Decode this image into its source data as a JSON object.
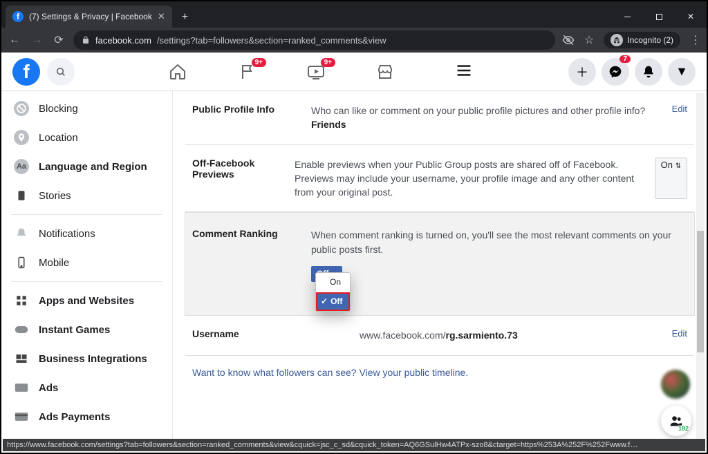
{
  "browser": {
    "tab_title": "(7) Settings & Privacy | Facebook",
    "url_host": "facebook.com",
    "url_path": "/settings?tab=followers&section=ranked_comments&view",
    "incognito_label": "Incognito (2)",
    "status_url": "https://www.facebook.com/settings?tab=followers&section=ranked_comments&view&cquick=jsc_c_sd&cquick_token=AQ6GSulHw4ATPx-szo8&ctarget=https%253A%252F%252Fwww.f…"
  },
  "header": {
    "badges": {
      "pages": "9+",
      "watch": "9+",
      "messenger": "7"
    }
  },
  "sidebar": {
    "items": [
      "Blocking",
      "Location",
      "Language and Region",
      "Stories",
      "Notifications",
      "Mobile",
      "Apps and Websites",
      "Instant Games",
      "Business Integrations",
      "Ads",
      "Ads Payments"
    ]
  },
  "settings": {
    "profile": {
      "label": "Public Profile Info",
      "desc_prefix": "Who can like or comment on your public profile pictures and other profile info? ",
      "desc_value": "Friends",
      "action": "Edit"
    },
    "previews": {
      "label": "Off-Facebook Previews",
      "desc": "Enable previews when your Public Group posts are shared off of Facebook. Previews may include your username, your profile image and any other content from your original post.",
      "action": "On",
      "action_icon": "⇅"
    },
    "ranking": {
      "label": "Comment Ranking",
      "desc": "When comment ranking is turned on, you'll see the most relevant comments on your public posts first.",
      "current": "Off",
      "options": {
        "on": "On",
        "off": "Off"
      }
    },
    "username": {
      "label": "Username",
      "prefix": "www.facebook.com/",
      "value": "rg.sarmiento.73",
      "action": "Edit"
    },
    "footer": "Want to know what followers can see? View your public timeline."
  },
  "people_widget": {
    "count": "182"
  }
}
